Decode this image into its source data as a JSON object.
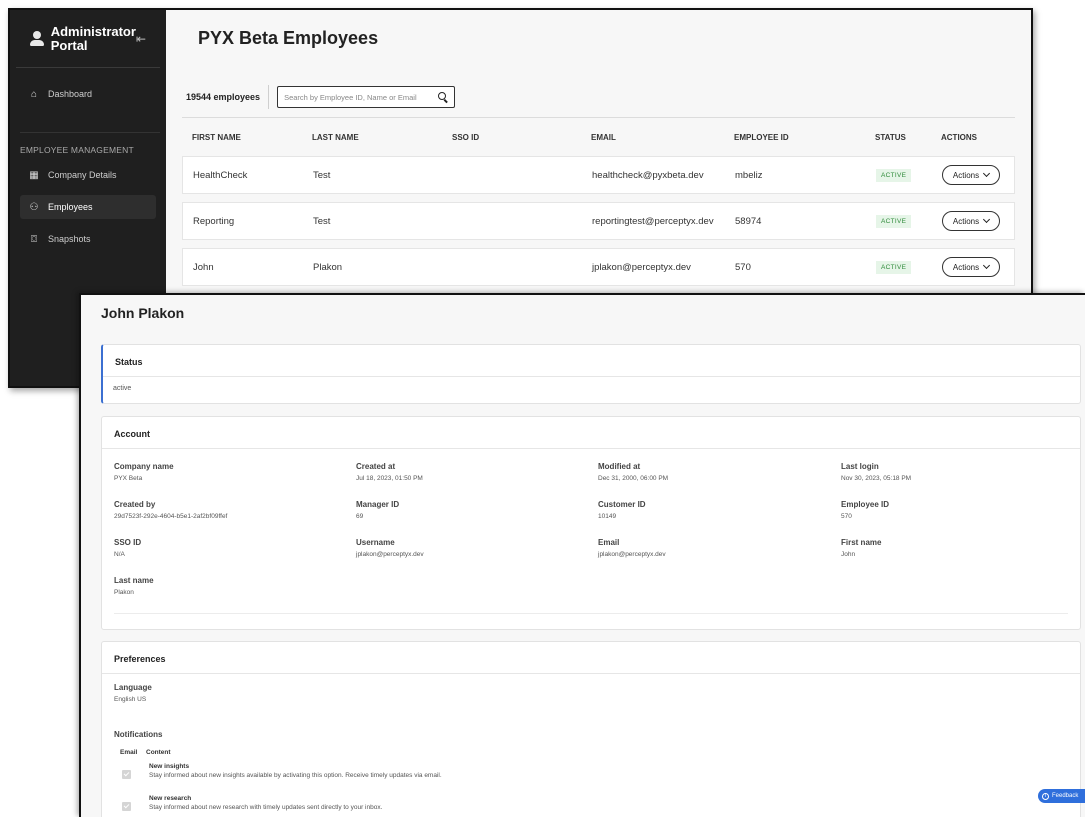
{
  "sidebar": {
    "brand": "Administrator Portal",
    "collapse_glyph": "⇤",
    "dashboard": "Dashboard",
    "section": "EMPLOYEE MANAGEMENT",
    "items": [
      {
        "label": "Company Details"
      },
      {
        "label": "Employees"
      },
      {
        "label": "Snapshots"
      }
    ]
  },
  "list": {
    "title": "PYX Beta Employees",
    "count": "19544 employees",
    "search_placeholder": "Search by Employee ID, Name or Email",
    "columns": [
      "FIRST NAME",
      "LAST NAME",
      "SSO ID",
      "EMAIL",
      "EMPLOYEE ID",
      "STATUS",
      "ACTIONS"
    ],
    "rows": [
      {
        "first": "HealthCheck",
        "last": "Test",
        "sso": "",
        "email": "healthcheck@pyxbeta.dev",
        "emp_id": "mbeliz",
        "status": "ACTIVE",
        "action": "Actions"
      },
      {
        "first": "Reporting",
        "last": "Test",
        "sso": "",
        "email": "reportingtest@perceptyx.dev",
        "emp_id": "58974",
        "status": "ACTIVE",
        "action": "Actions"
      },
      {
        "first": "John",
        "last": "Plakon",
        "sso": "",
        "email": "jplakon@perceptyx.dev",
        "emp_id": "570",
        "status": "ACTIVE",
        "action": "Actions"
      }
    ]
  },
  "detail": {
    "title": "John Plakon",
    "status_card": {
      "title": "Status",
      "value": "active"
    },
    "account": {
      "title": "Account",
      "fields": [
        {
          "label": "Company name",
          "value": "PYX Beta"
        },
        {
          "label": "Created at",
          "value": "Jul 18, 2023, 01:50 PM"
        },
        {
          "label": "Modified at",
          "value": "Dec 31, 2000, 06:00 PM"
        },
        {
          "label": "Last login",
          "value": "Nov 30, 2023, 05:18 PM"
        },
        {
          "label": "Created by",
          "value": "29d7523f-292e-4604-b5e1-2af2bf09ffef"
        },
        {
          "label": "Manager ID",
          "value": "69"
        },
        {
          "label": "Customer ID",
          "value": "10149"
        },
        {
          "label": "Employee ID",
          "value": "570"
        },
        {
          "label": "SSO ID",
          "value": "N/A"
        },
        {
          "label": "Username",
          "value": "jplakon@perceptyx.dev"
        },
        {
          "label": "Email",
          "value": "jplakon@perceptyx.dev"
        },
        {
          "label": "First name",
          "value": "John"
        },
        {
          "label": "Last name",
          "value": "Plakon"
        }
      ]
    },
    "preferences": {
      "title": "Preferences",
      "language_label": "Language",
      "language_value": "English US",
      "notifications_label": "Notifications",
      "col_email": "Email",
      "col_content": "Content",
      "items": [
        {
          "title": "New insights",
          "desc": "Stay informed about new insights available by activating this option. Receive timely updates via email."
        },
        {
          "title": "New research",
          "desc": "Stay informed about new research with timely updates sent directly to your inbox."
        }
      ]
    }
  },
  "feedback": {
    "label": "Feedback"
  }
}
